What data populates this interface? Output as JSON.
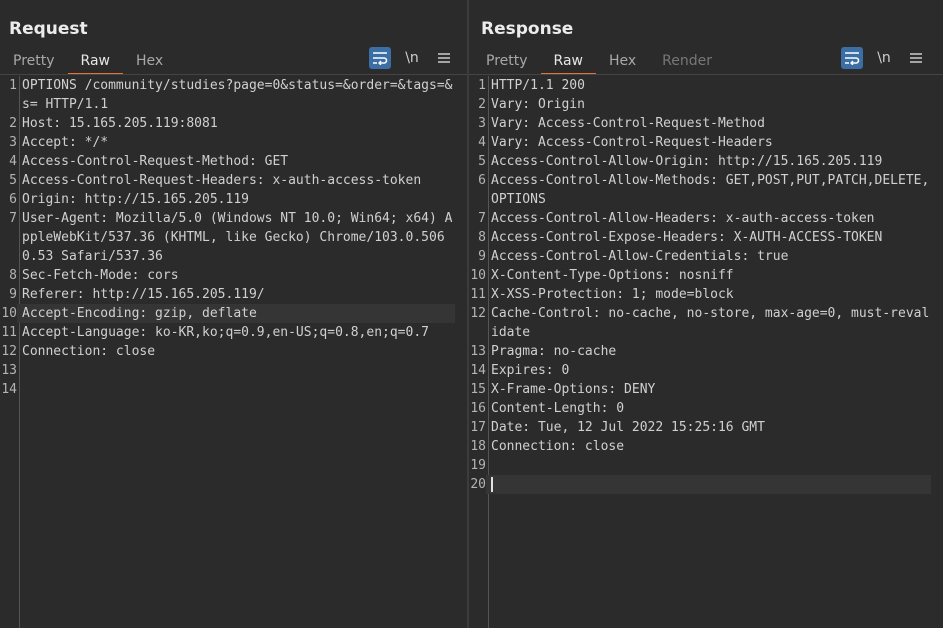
{
  "request": {
    "title": "Request",
    "tabs": [
      {
        "label": "Pretty",
        "active": false
      },
      {
        "label": "Raw",
        "active": true
      },
      {
        "label": "Hex",
        "active": false
      }
    ],
    "tools": {
      "newline_label": "\\n"
    },
    "lines": [
      {
        "n": "1",
        "text": "OPTIONS /community/studies?page=0&status=&order=&tags=&s= HTTP/1.1"
      },
      {
        "n": "2",
        "text": "Host: 15.165.205.119:8081"
      },
      {
        "n": "3",
        "text": "Accept: */*"
      },
      {
        "n": "4",
        "text": "Access-Control-Request-Method: GET"
      },
      {
        "n": "5",
        "text": "Access-Control-Request-Headers: x-auth-access-token"
      },
      {
        "n": "6",
        "text": "Origin: http://15.165.205.119"
      },
      {
        "n": "7",
        "text": "User-Agent: Mozilla/5.0 (Windows NT 10.0; Win64; x64) AppleWebKit/537.36 (KHTML, like Gecko) Chrome/103.0.5060.53 Safari/537.36"
      },
      {
        "n": "8",
        "text": "Sec-Fetch-Mode: cors"
      },
      {
        "n": "9",
        "text": "Referer: http://15.165.205.119/"
      },
      {
        "n": "10",
        "text": "Accept-Encoding: gzip, deflate",
        "highlight": true
      },
      {
        "n": "11",
        "text": "Accept-Language: ko-KR,ko;q=0.9,en-US;q=0.8,en;q=0.7"
      },
      {
        "n": "12",
        "text": "Connection: close"
      },
      {
        "n": "13",
        "text": ""
      },
      {
        "n": "14",
        "text": ""
      }
    ]
  },
  "response": {
    "title": "Response",
    "tabs": [
      {
        "label": "Pretty",
        "active": false
      },
      {
        "label": "Raw",
        "active": true
      },
      {
        "label": "Hex",
        "active": false
      },
      {
        "label": "Render",
        "active": false,
        "dim": true
      }
    ],
    "tools": {
      "newline_label": "\\n"
    },
    "lines": [
      {
        "n": "1",
        "text": "HTTP/1.1 200"
      },
      {
        "n": "2",
        "text": "Vary: Origin"
      },
      {
        "n": "3",
        "text": "Vary: Access-Control-Request-Method"
      },
      {
        "n": "4",
        "text": "Vary: Access-Control-Request-Headers"
      },
      {
        "n": "5",
        "text": "Access-Control-Allow-Origin: http://15.165.205.119"
      },
      {
        "n": "6",
        "text": "Access-Control-Allow-Methods: GET,POST,PUT,PATCH,DELETE,OPTIONS"
      },
      {
        "n": "7",
        "text": "Access-Control-Allow-Headers: x-auth-access-token"
      },
      {
        "n": "8",
        "text": "Access-Control-Expose-Headers: X-AUTH-ACCESS-TOKEN"
      },
      {
        "n": "9",
        "text": "Access-Control-Allow-Credentials: true"
      },
      {
        "n": "10",
        "text": "X-Content-Type-Options: nosniff"
      },
      {
        "n": "11",
        "text": "X-XSS-Protection: 1; mode=block"
      },
      {
        "n": "12",
        "text": "Cache-Control: no-cache, no-store, max-age=0, must-revalidate"
      },
      {
        "n": "13",
        "text": "Pragma: no-cache"
      },
      {
        "n": "14",
        "text": "Expires: 0"
      },
      {
        "n": "15",
        "text": "X-Frame-Options: DENY"
      },
      {
        "n": "16",
        "text": "Content-Length: 0"
      },
      {
        "n": "17",
        "text": "Date: Tue, 12 Jul 2022 15:25:16 GMT"
      },
      {
        "n": "18",
        "text": "Connection: close"
      },
      {
        "n": "19",
        "text": ""
      },
      {
        "n": "20",
        "text": "",
        "highlight": true,
        "cursor": true
      }
    ]
  },
  "colors": {
    "accent": "#e8703a",
    "toggle_on": "#3a6ea5"
  }
}
